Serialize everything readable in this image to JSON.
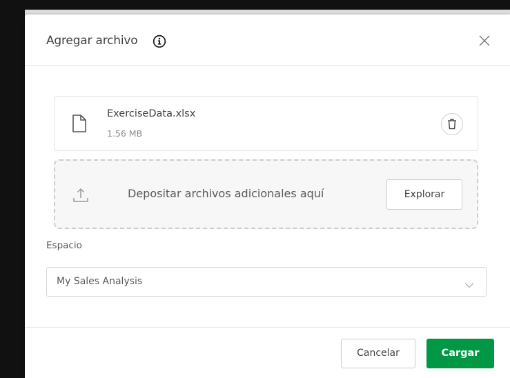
{
  "dialog": {
    "title": "Agregar archivo",
    "info_icon": "info-circle-icon",
    "close_icon": "close-icon"
  },
  "file": {
    "name": "ExerciseData.xlsx",
    "size": "1.56 MB",
    "icon": "file-icon",
    "delete_icon": "trash-icon"
  },
  "dropzone": {
    "text": "Depositar archivos adicionales aquí",
    "browse_label": "Explorar",
    "icon": "upload-icon"
  },
  "space": {
    "label": "Espacio",
    "selected": "My Sales Analysis"
  },
  "footer": {
    "cancel_label": "Cancelar",
    "upload_label": "Cargar"
  },
  "colors": {
    "primary": "#009845",
    "text": "#404040",
    "border": "#cccccc"
  }
}
